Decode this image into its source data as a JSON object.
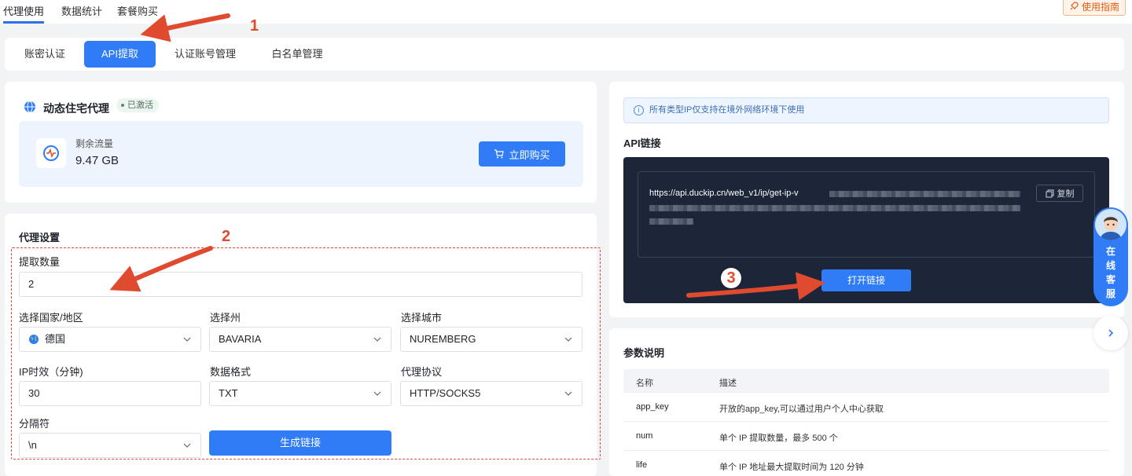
{
  "topnav": {
    "tabs": [
      "代理使用",
      "数据统计",
      "套餐购买"
    ],
    "guide_label": "使用指南"
  },
  "subtabs": [
    "账密认证",
    "API提取",
    "认证账号管理",
    "白名单管理"
  ],
  "proxy_card": {
    "title": "动态住宅代理",
    "badge": "已激活",
    "flow_label": "剩余流量",
    "flow_value": "9.47 GB",
    "buy_label": "立即购买"
  },
  "settings": {
    "title": "代理设置",
    "count_label": "提取数量",
    "count_value": "2",
    "country_label": "选择国家/地区",
    "country_value": "德国",
    "state_label": "选择州",
    "state_value": "BAVARIA",
    "city_label": "选择城市",
    "city_value": "NUREMBERG",
    "life_label": "IP时效（分钟)",
    "life_value": "30",
    "format_label": "数据格式",
    "format_value": "TXT",
    "protocol_label": "代理协议",
    "protocol_value": "HTTP/SOCKS5",
    "separator_label": "分隔符",
    "separator_value": "\\n",
    "generate_label": "生成链接"
  },
  "api": {
    "notice": "所有类型IP仅支持在境外网络环境下使用",
    "title": "API链接",
    "url_visible": "https://api.duckip.cn/web_v1/ip/get-ip-v",
    "copy_label": "复制",
    "open_label": "打开链接"
  },
  "params": {
    "title": "参数说明",
    "headers": [
      "名称",
      "描述"
    ],
    "rows": [
      [
        "app_key",
        "开放的app_key,可以通过用户个人中心获取"
      ],
      [
        "num",
        "单个 IP 提取数量，最多 500 个"
      ],
      [
        "life",
        "单个 IP 地址最大提取时间为 120 分钟"
      ]
    ]
  },
  "service": {
    "chars": [
      "在",
      "线",
      "客",
      "服"
    ]
  },
  "annotations": [
    "1",
    "2",
    "3"
  ],
  "colors": {
    "primary": "#2f7cf6",
    "annotation": "#e04a2f",
    "dark_panel": "#1d2538"
  }
}
